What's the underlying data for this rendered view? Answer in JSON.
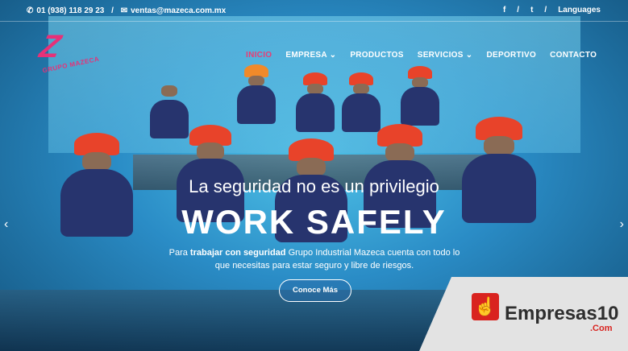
{
  "topbar": {
    "phone": "01 (938) 118 29 23",
    "separator": "/",
    "email": "ventas@mazeca.com.mx",
    "social": [
      "f",
      "t"
    ],
    "languages": "Languages"
  },
  "logo": {
    "mark": "Z",
    "brand": "GRUPO MAZECA"
  },
  "nav": {
    "items": [
      {
        "label": "INICIO",
        "active": true
      },
      {
        "label": "EMPRESA ⌄",
        "active": false
      },
      {
        "label": "PRODUCTOS",
        "active": false
      },
      {
        "label": "SERVICIOS ⌄",
        "active": false
      },
      {
        "label": "DEPORTIVO",
        "active": false
      },
      {
        "label": "CONTACTO",
        "active": false
      }
    ]
  },
  "hero": {
    "tagline": "La seguridad no es un privilegio",
    "headline": "WORK SAFELY",
    "desc_pre": "Para ",
    "desc_bold": "trabajar con seguridad",
    "desc_post": " Grupo Industrial Mazeca cuenta con todo lo que necesitas para estar seguro y libre de riesgos.",
    "cta": "Conoce Más"
  },
  "slider": {
    "prev": "‹",
    "next": "›"
  },
  "badge": {
    "name": "Empresas10",
    "com": ".Com"
  },
  "colors": {
    "accent": "#ea3c73",
    "brand_red": "#d9231f",
    "helmet": "#e8432a"
  }
}
